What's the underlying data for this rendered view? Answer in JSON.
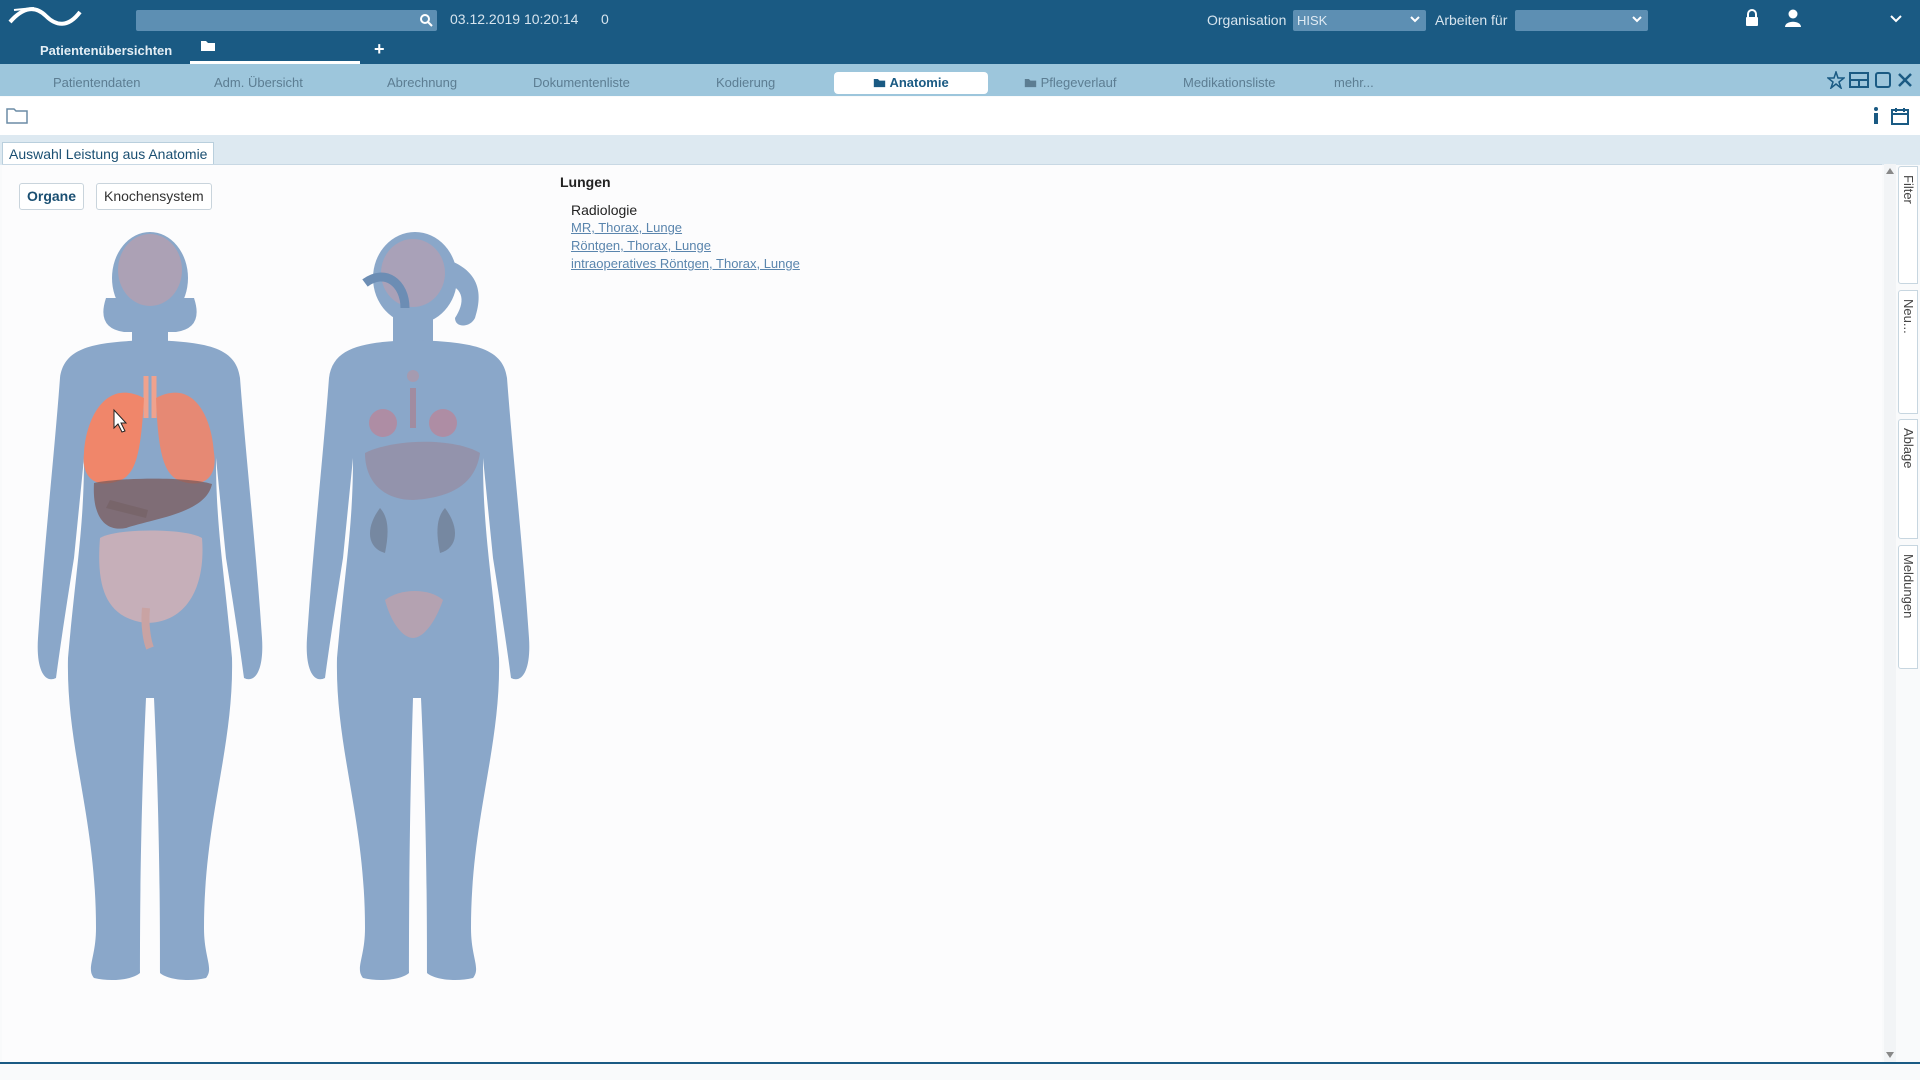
{
  "header": {
    "datetime": "03.12.2019 10:20:14",
    "counter": "0",
    "organisation_label": "Organisation",
    "organisation_value": "HISK",
    "arbeiten_label": "Arbeiten für",
    "arbeiten_value": "",
    "subtab": "Patientenübersichten"
  },
  "nav": {
    "tabs": [
      {
        "label": "Patientendaten"
      },
      {
        "label": "Adm. Übersicht"
      },
      {
        "label": "Abrechnung"
      },
      {
        "label": "Dokumentenliste"
      },
      {
        "label": "Kodierung"
      },
      {
        "label": "Anatomie"
      },
      {
        "label": "Pflegeverlauf"
      },
      {
        "label": "Medikationsliste"
      },
      {
        "label": "mehr..."
      }
    ]
  },
  "panel": {
    "title": "Auswahl Leistung aus Anatomie",
    "buttons": [
      {
        "label": "Organe"
      },
      {
        "label": "Knochensystem"
      }
    ]
  },
  "organ": {
    "name": "Lungen",
    "department": "Radiologie",
    "services": [
      "MR, Thorax, Lunge",
      "Röntgen, Thorax, Lunge",
      "intraoperatives Röntgen, Thorax, Lunge"
    ]
  },
  "side_tabs": [
    "Filter",
    "Neu...",
    "Ablage",
    "Meldungen"
  ],
  "colors": {
    "header_bg": "#1a5a83",
    "nav_bg": "#9dc6dc",
    "body_silhouette": "#8aa7c9",
    "lung_highlight": "#f0866a"
  },
  "icons": [
    "search-icon",
    "chevron-down-icon",
    "lock-icon",
    "user-icon",
    "folder-icon",
    "star-icon",
    "window-icon",
    "maximize-icon",
    "close-icon",
    "info-icon",
    "calendar-icon",
    "plus-icon"
  ]
}
